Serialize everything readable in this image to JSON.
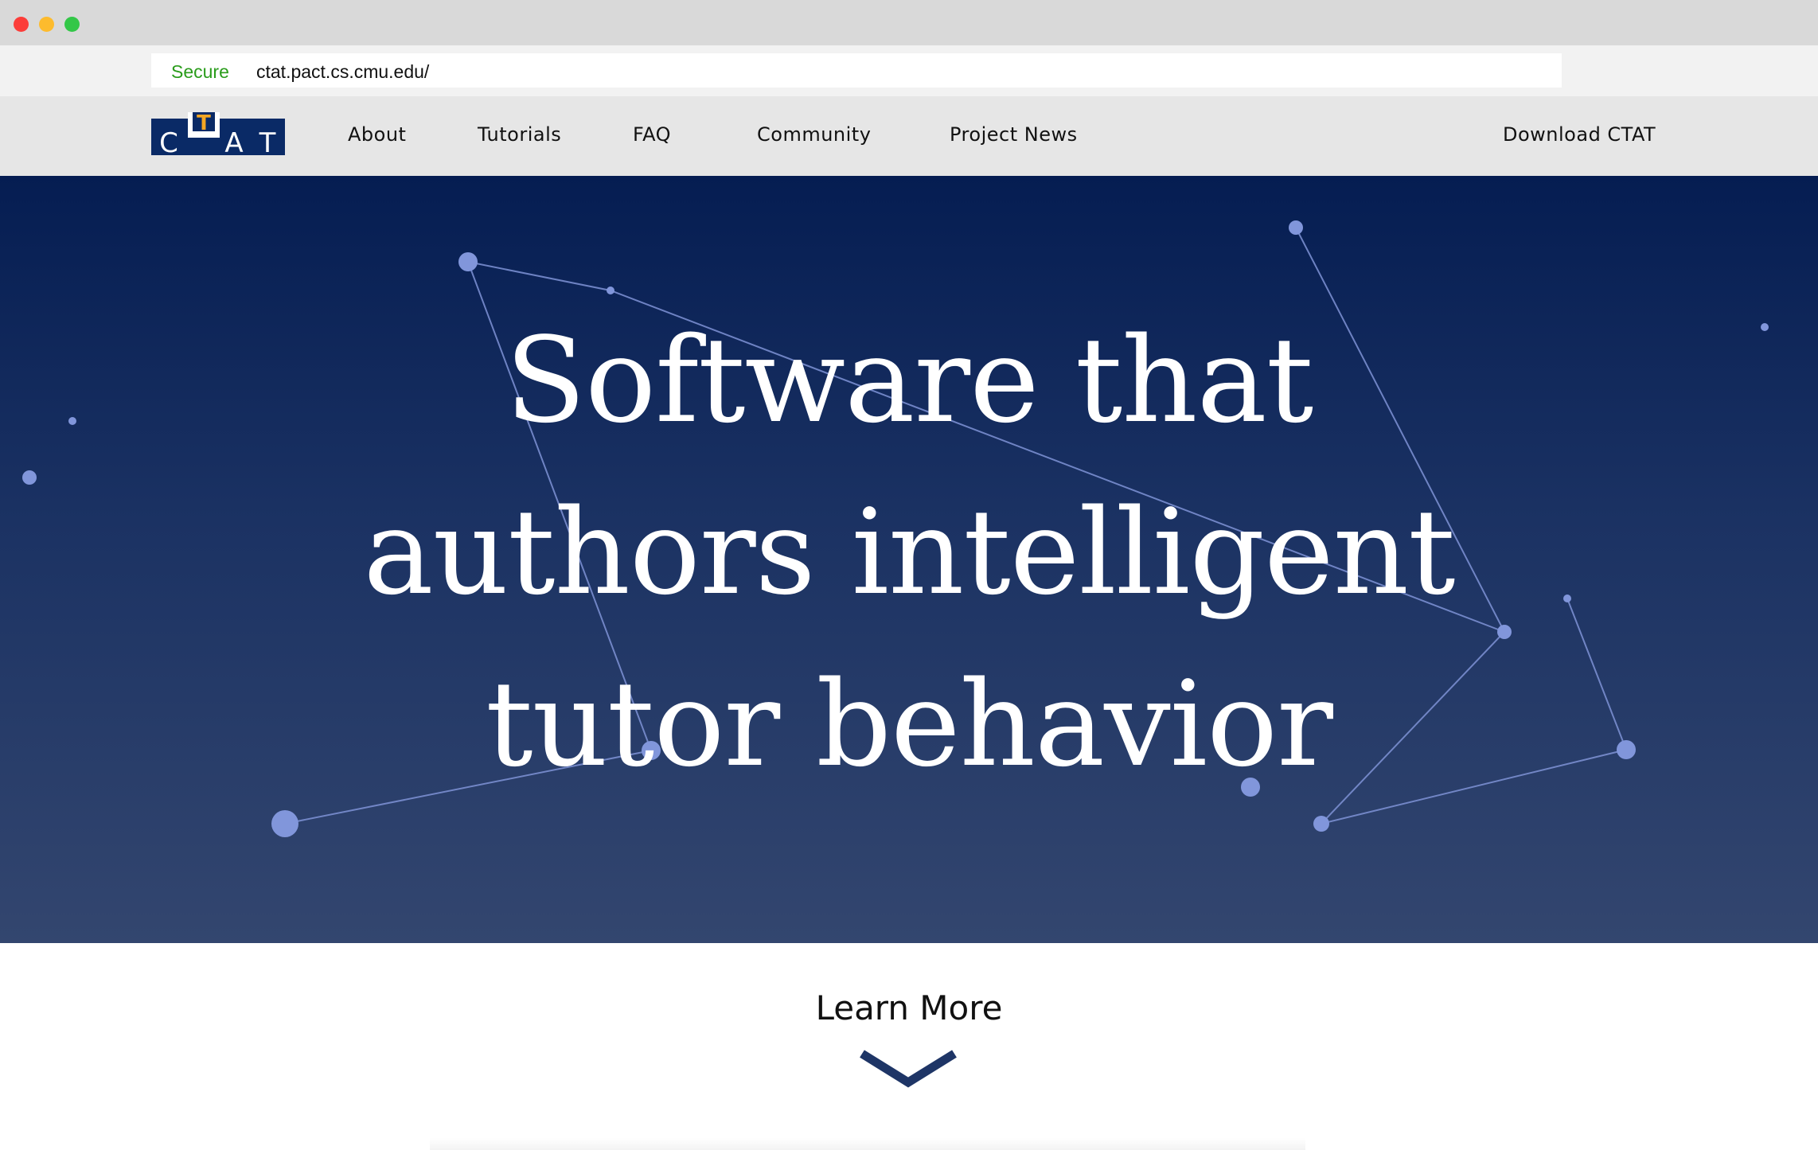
{
  "browser": {
    "secure_label": "Secure",
    "url": "ctat.pact.cs.cmu.edu/",
    "traffic_lights": {
      "close_color": "#fc3d39",
      "minimize_color": "#fdbb2d",
      "maximize_color": "#33c748"
    }
  },
  "nav": {
    "logo_text": "CTAT",
    "items": [
      {
        "label": "About"
      },
      {
        "label": "Tutorials"
      },
      {
        "label": "FAQ"
      },
      {
        "label": "Community"
      },
      {
        "label": "Project News"
      }
    ],
    "download_label": "Download CTAT"
  },
  "hero": {
    "headline_lines": [
      "Software that",
      "authors intelligent",
      "tutor behavior"
    ],
    "background_top": "#051d52",
    "background_bottom": "#33466f",
    "constellation_color": "#7f93d6"
  },
  "learn_more": {
    "label": "Learn More",
    "chevron_icon": "chevron-down-icon",
    "chevron_color": "#1e3566"
  },
  "colors": {
    "brand_navy": "#0a2a66",
    "logo_accent": "#f5a623",
    "nav_background": "#e6e6e6"
  }
}
